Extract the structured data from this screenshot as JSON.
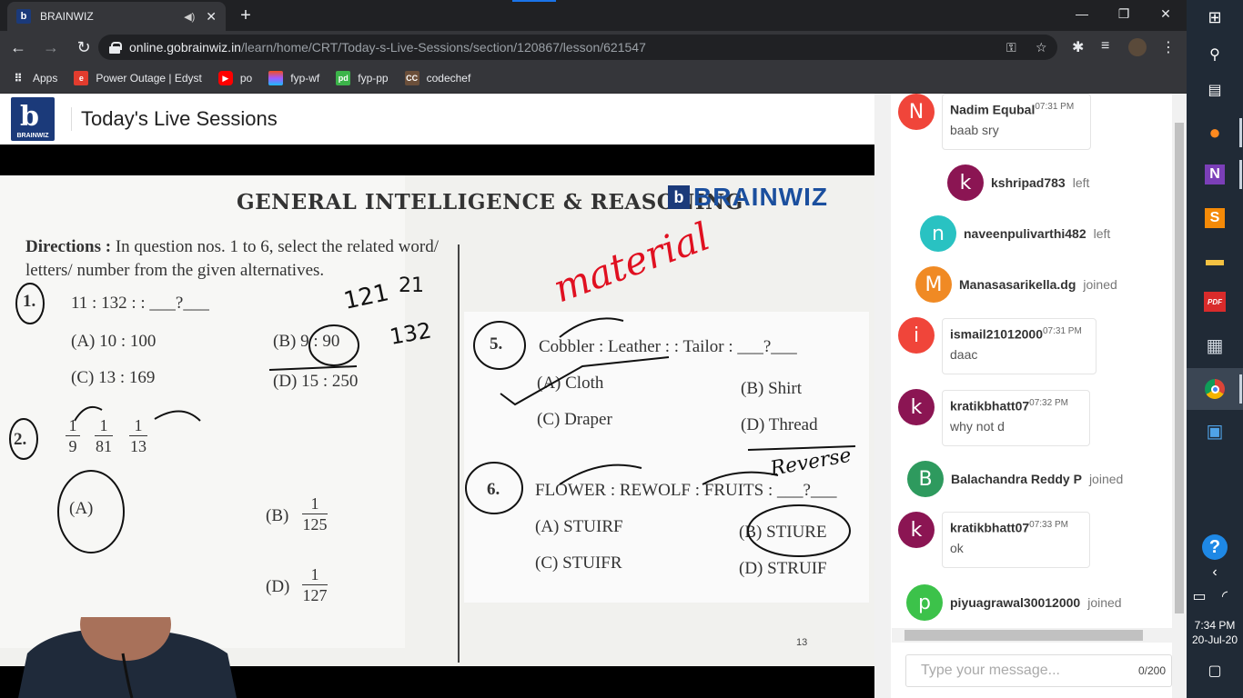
{
  "browser": {
    "tab_title": "BRAINWIZ",
    "tab_favicon": "b",
    "url_host": "online.gobrainwiz.in",
    "url_path": "/learn/home/CRT/Today-s-Live-Sessions/section/120867/lesson/621547",
    "bookmarks": [
      "Apps",
      "Power Outage | Edyst",
      "po",
      "fyp-wf",
      "fyp-pp",
      "codechef"
    ]
  },
  "page": {
    "title": "Today's Live Sessions",
    "logo_text": "BRAINWIZ"
  },
  "slide": {
    "heading": "GENERAL INTELLIGENCE & REASONING",
    "brand": "BRAINWIZ",
    "directions_label": "Directions :",
    "directions_text": "In question nos. 1 to 6, select the related word/ letters/ number from the given alternatives.",
    "q1": "1.",
    "q1_stem": "11 : 132 : : ___?___",
    "q1_a": "(A)  10 : 100",
    "q1_b": "(B)  9 : 90",
    "q1_c": "(C)  13 : 169",
    "q1_d": "(D)  15 : 250",
    "q2": "2.",
    "q2_f1": [
      "1",
      "9"
    ],
    "q2_f2": [
      "1",
      "81"
    ],
    "q2_f3": [
      "1",
      "13"
    ],
    "q2_a": "(A)",
    "q2_b": "(B)",
    "q2_b_frac": [
      "1",
      "125"
    ],
    "q2_d": "(D)",
    "q2_d_frac": [
      "1",
      "127"
    ],
    "q5": "5.",
    "q5_stem": "Cobbler : Leather : : Tailor : ___?___",
    "q5_a": "(A)  Cloth",
    "q5_b": "(B)  Shirt",
    "q5_c": "(C)  Draper",
    "q5_d": "(D)  Thread",
    "q6": "6.",
    "q6_stem": "FLOWER : REWOLF : FRUITS : ___?___",
    "q6_a": "(A)  STUIRF",
    "q6_b": "(B)  STIURE",
    "q6_c": "(C)  STUIFR",
    "q6_d": "(D)  STRUIF",
    "page_number": "13",
    "annotations": {
      "material": "material",
      "reverse": "Reverse",
      "n121": "121",
      "n21": "21",
      "n132": "132"
    }
  },
  "chat": {
    "messages": [
      {
        "type": "msg",
        "initial": "N",
        "color": "#f0453a",
        "name": "Nadim Equbal",
        "time": "07:31 PM",
        "text": "baab sry"
      },
      {
        "type": "sys",
        "initial": "k",
        "color": "#8b1553",
        "name": "kshripad783",
        "action": "left"
      },
      {
        "type": "sys",
        "initial": "n",
        "color": "#29c2c2",
        "name": "naveenpulivarthi482",
        "action": "left"
      },
      {
        "type": "sys",
        "initial": "M",
        "color": "#f08a24",
        "name": "Manasasarikella.dg",
        "action": "joined"
      },
      {
        "type": "msg",
        "initial": "i",
        "color": "#f0453a",
        "name": "ismail21012000",
        "time": "07:31 PM",
        "text": "daac"
      },
      {
        "type": "msg",
        "initial": "k",
        "color": "#8b1553",
        "name": "kratikbhatt07",
        "time": "07:32 PM",
        "text": "why not d"
      },
      {
        "type": "sys",
        "initial": "B",
        "color": "#2e9a5e",
        "name": "Balachandra Reddy P",
        "action": "joined"
      },
      {
        "type": "msg",
        "initial": "k",
        "color": "#8b1553",
        "name": "kratikbhatt07",
        "time": "07:33 PM",
        "text": "ok"
      },
      {
        "type": "sys",
        "initial": "p",
        "color": "#3cc24a",
        "name": "piyuagrawal30012000",
        "action": "joined"
      }
    ],
    "input_placeholder": "Type your message...",
    "char_count": "0/200"
  },
  "taskbar": {
    "time": "7:34 PM",
    "date": "20-Jul-20"
  }
}
